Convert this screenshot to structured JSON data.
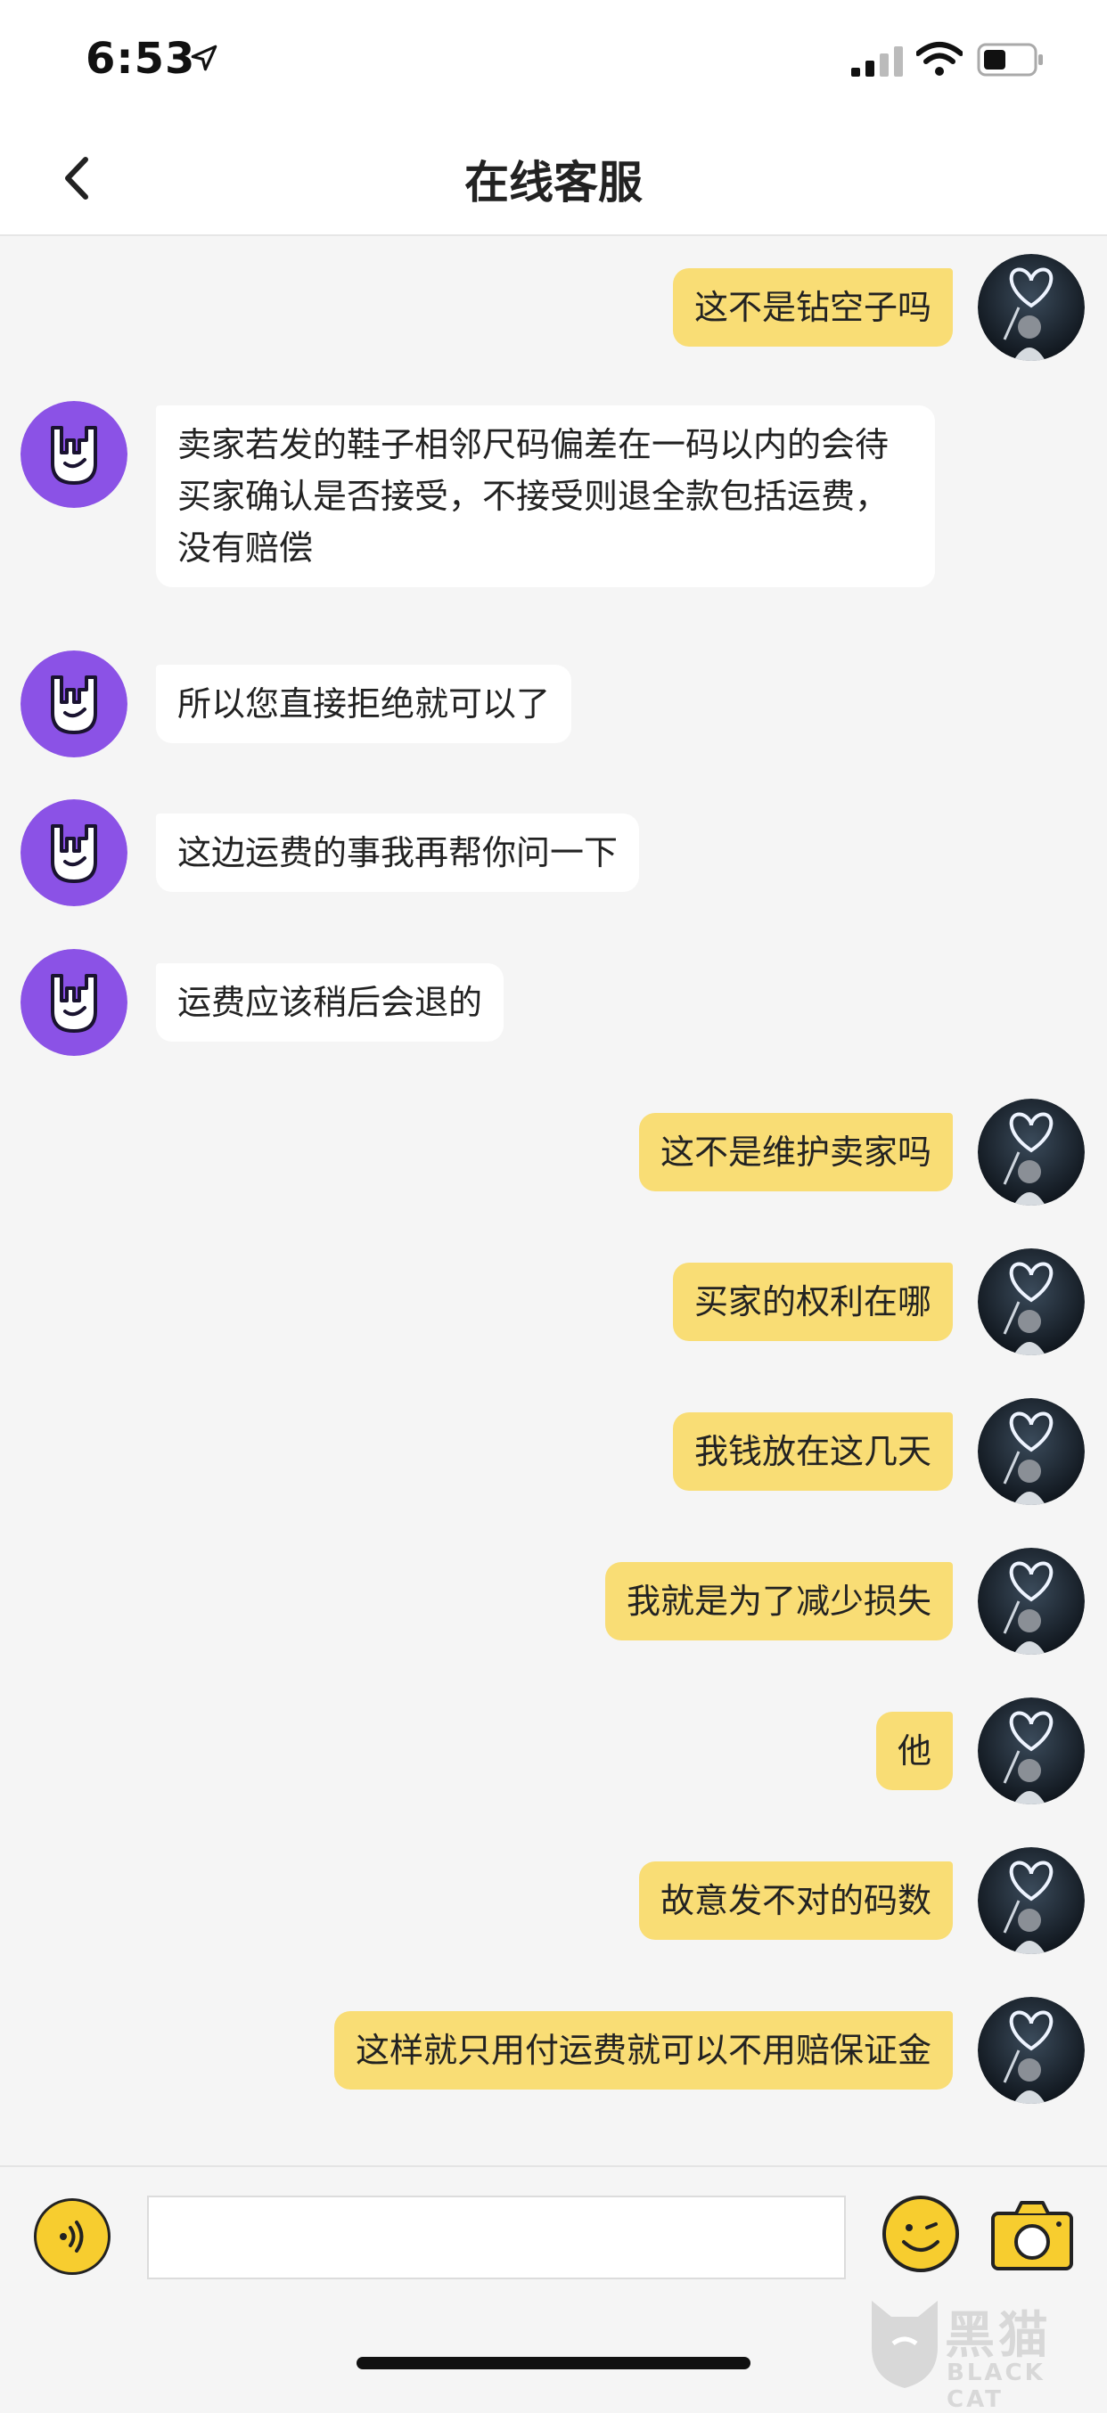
{
  "status_bar": {
    "time": "6:53",
    "icons": [
      "location-arrow-icon",
      "signal-icon",
      "wifi-icon",
      "battery-icon"
    ]
  },
  "header": {
    "title": "在线客服",
    "back_icon": "chevron-left-icon"
  },
  "messages": [
    {
      "sender": "me",
      "text": "这不是钻空子吗"
    },
    {
      "sender": "them",
      "text": "卖家若发的鞋子相邻尺码偏差在一码以内的会待买家确认是否接受，不接受则退全款包括运费，没有赔偿"
    },
    {
      "sender": "them",
      "text": "所以您直接拒绝就可以了"
    },
    {
      "sender": "them",
      "text": "这边运费的事我再帮你问一下"
    },
    {
      "sender": "them",
      "text": "运费应该稍后会退的"
    },
    {
      "sender": "me",
      "text": "这不是维护卖家吗"
    },
    {
      "sender": "me",
      "text": "买家的权利在哪"
    },
    {
      "sender": "me",
      "text": "我钱放在这几天"
    },
    {
      "sender": "me",
      "text": "我就是为了减少损失"
    },
    {
      "sender": "me",
      "text": "他"
    },
    {
      "sender": "me",
      "text": "故意发不对的码数"
    },
    {
      "sender": "me",
      "text": "这样就只用付运费就可以不用赔保证金"
    }
  ],
  "input_bar": {
    "voice_icon": "voice-icon",
    "text_value": "",
    "emoji_icon": "emoji-icon",
    "camera_icon": "camera-icon"
  },
  "watermark": {
    "cn": "黑猫",
    "en": "BLACK CAT"
  },
  "colors": {
    "my_bubble": "#f9dd75",
    "their_bubble": "#ffffff",
    "agent_avatar": "#8b52e6",
    "accent_yellow": "#f7cd2f"
  }
}
